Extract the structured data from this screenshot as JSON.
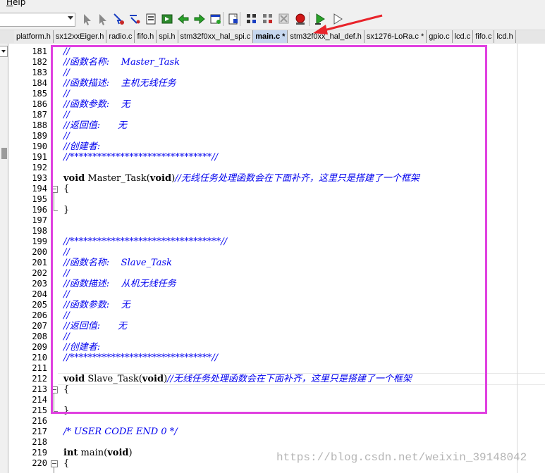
{
  "menubar": {
    "help_label": "Help"
  },
  "toolbar": {
    "combo_value": "",
    "icons": [
      "pointer-tool-icon",
      "pointer-tool-icon",
      "find-in-files-icon",
      "replace-icon",
      "insert-breakpoint-icon",
      "build-icon",
      "go-back-icon",
      "go-forward-icon",
      "window-icon",
      "toggle-bookmark-icon",
      "browse-icon",
      "find-refs-icon",
      "disable-icon",
      "stop-icon",
      "start-debug-icon",
      "step-icon"
    ]
  },
  "tabs": [
    {
      "label": "platform.h",
      "active": false
    },
    {
      "label": "sx12xxEiger.h",
      "active": false
    },
    {
      "label": "radio.c",
      "active": false
    },
    {
      "label": "fifo.h",
      "active": false
    },
    {
      "label": "spi.h",
      "active": false
    },
    {
      "label": "stm32f0xx_hal_spi.c",
      "active": false
    },
    {
      "label": "main.c *",
      "active": true
    },
    {
      "label": "stm32f0xx_hal_def.h",
      "active": false
    },
    {
      "label": "sx1276-LoRa.c *",
      "active": false
    },
    {
      "label": "gpio.c",
      "active": false
    },
    {
      "label": "lcd.c",
      "active": false
    },
    {
      "label": "fifo.c",
      "active": false
    },
    {
      "label": "lcd.h",
      "active": false
    }
  ],
  "editor": {
    "lines": [
      {
        "n": "181",
        "segs": [
          {
            "t": "//",
            "c": "cm"
          }
        ]
      },
      {
        "n": "182",
        "segs": [
          {
            "t": "//函数名称:    Master_Task",
            "c": "cm"
          }
        ]
      },
      {
        "n": "183",
        "segs": [
          {
            "t": "//",
            "c": "cm"
          }
        ]
      },
      {
        "n": "184",
        "segs": [
          {
            "t": "//函数描述:    主机无线任务",
            "c": "cm"
          }
        ]
      },
      {
        "n": "185",
        "segs": [
          {
            "t": "//",
            "c": "cm"
          }
        ]
      },
      {
        "n": "186",
        "segs": [
          {
            "t": "//函数参数:    无",
            "c": "cm"
          }
        ]
      },
      {
        "n": "187",
        "segs": [
          {
            "t": "//",
            "c": "cm"
          }
        ]
      },
      {
        "n": "188",
        "segs": [
          {
            "t": "//返回值:      无",
            "c": "cm"
          }
        ]
      },
      {
        "n": "189",
        "segs": [
          {
            "t": "//",
            "c": "cm"
          }
        ]
      },
      {
        "n": "190",
        "segs": [
          {
            "t": "//创建者:",
            "c": "cm"
          }
        ]
      },
      {
        "n": "191",
        "segs": [
          {
            "t": "//*******************************//",
            "c": "cm"
          }
        ]
      },
      {
        "n": "192",
        "segs": []
      },
      {
        "n": "193",
        "segs": [
          {
            "t": "void",
            "c": "kw"
          },
          {
            "t": " Master_Task(",
            "c": ""
          },
          {
            "t": "void",
            "c": "kw"
          },
          {
            "t": ")",
            "c": ""
          },
          {
            "t": "//无线任务处理函数会在下面补齐，这里只是搭建了一个框架",
            "c": "cm"
          }
        ]
      },
      {
        "n": "194",
        "segs": [
          {
            "t": "{",
            "c": ""
          }
        ]
      },
      {
        "n": "195",
        "segs": []
      },
      {
        "n": "196",
        "segs": [
          {
            "t": "}",
            "c": ""
          }
        ]
      },
      {
        "n": "197",
        "segs": []
      },
      {
        "n": "198",
        "segs": []
      },
      {
        "n": "199",
        "segs": [
          {
            "t": "//*********************************//",
            "c": "cm"
          }
        ]
      },
      {
        "n": "200",
        "segs": [
          {
            "t": "//",
            "c": "cm"
          }
        ]
      },
      {
        "n": "201",
        "segs": [
          {
            "t": "//函数名称:    Slave_Task",
            "c": "cm"
          }
        ]
      },
      {
        "n": "202",
        "segs": [
          {
            "t": "//",
            "c": "cm"
          }
        ]
      },
      {
        "n": "203",
        "segs": [
          {
            "t": "//函数描述:    从机无线任务",
            "c": "cm"
          }
        ]
      },
      {
        "n": "204",
        "segs": [
          {
            "t": "//",
            "c": "cm"
          }
        ]
      },
      {
        "n": "205",
        "segs": [
          {
            "t": "//函数参数:    无",
            "c": "cm"
          }
        ]
      },
      {
        "n": "206",
        "segs": [
          {
            "t": "//",
            "c": "cm"
          }
        ]
      },
      {
        "n": "207",
        "segs": [
          {
            "t": "//返回值:      无",
            "c": "cm"
          }
        ]
      },
      {
        "n": "208",
        "segs": [
          {
            "t": "//",
            "c": "cm"
          }
        ]
      },
      {
        "n": "209",
        "segs": [
          {
            "t": "//创建者:",
            "c": "cm"
          }
        ]
      },
      {
        "n": "210",
        "segs": [
          {
            "t": "//*******************************//",
            "c": "cm"
          }
        ]
      },
      {
        "n": "211",
        "segs": []
      },
      {
        "n": "212",
        "segs": [
          {
            "t": "void",
            "c": "kw"
          },
          {
            "t": " Slave_Task(",
            "c": ""
          },
          {
            "t": "void",
            "c": "kw"
          },
          {
            "t": ")",
            "c": ""
          },
          {
            "t": "//无线任务处理函数会在下面补齐，这里只是搭建了一个框架",
            "c": "cm"
          }
        ]
      },
      {
        "n": "213",
        "segs": [
          {
            "t": "{",
            "c": ""
          }
        ]
      },
      {
        "n": "214",
        "segs": []
      },
      {
        "n": "215",
        "segs": [
          {
            "t": "}",
            "c": ""
          }
        ]
      },
      {
        "n": "216",
        "segs": []
      },
      {
        "n": "217",
        "segs": [
          {
            "t": "/* USER CODE END 0 */",
            "c": "cm"
          }
        ]
      },
      {
        "n": "218",
        "segs": []
      },
      {
        "n": "219",
        "segs": [
          {
            "t": "int",
            "c": "kw"
          },
          {
            "t": " main(",
            "c": ""
          },
          {
            "t": "void",
            "c": "kw"
          },
          {
            "t": ")",
            "c": ""
          }
        ]
      },
      {
        "n": "220",
        "segs": [
          {
            "t": "{",
            "c": ""
          }
        ]
      }
    ],
    "fold_open_lines": [
      "194",
      "213",
      "220"
    ]
  },
  "annotation": {
    "box_color": "#e040e0",
    "arrow_color": "#e8232a"
  },
  "watermark": {
    "text": "https://blog.csdn.net/weixin_39148042"
  }
}
